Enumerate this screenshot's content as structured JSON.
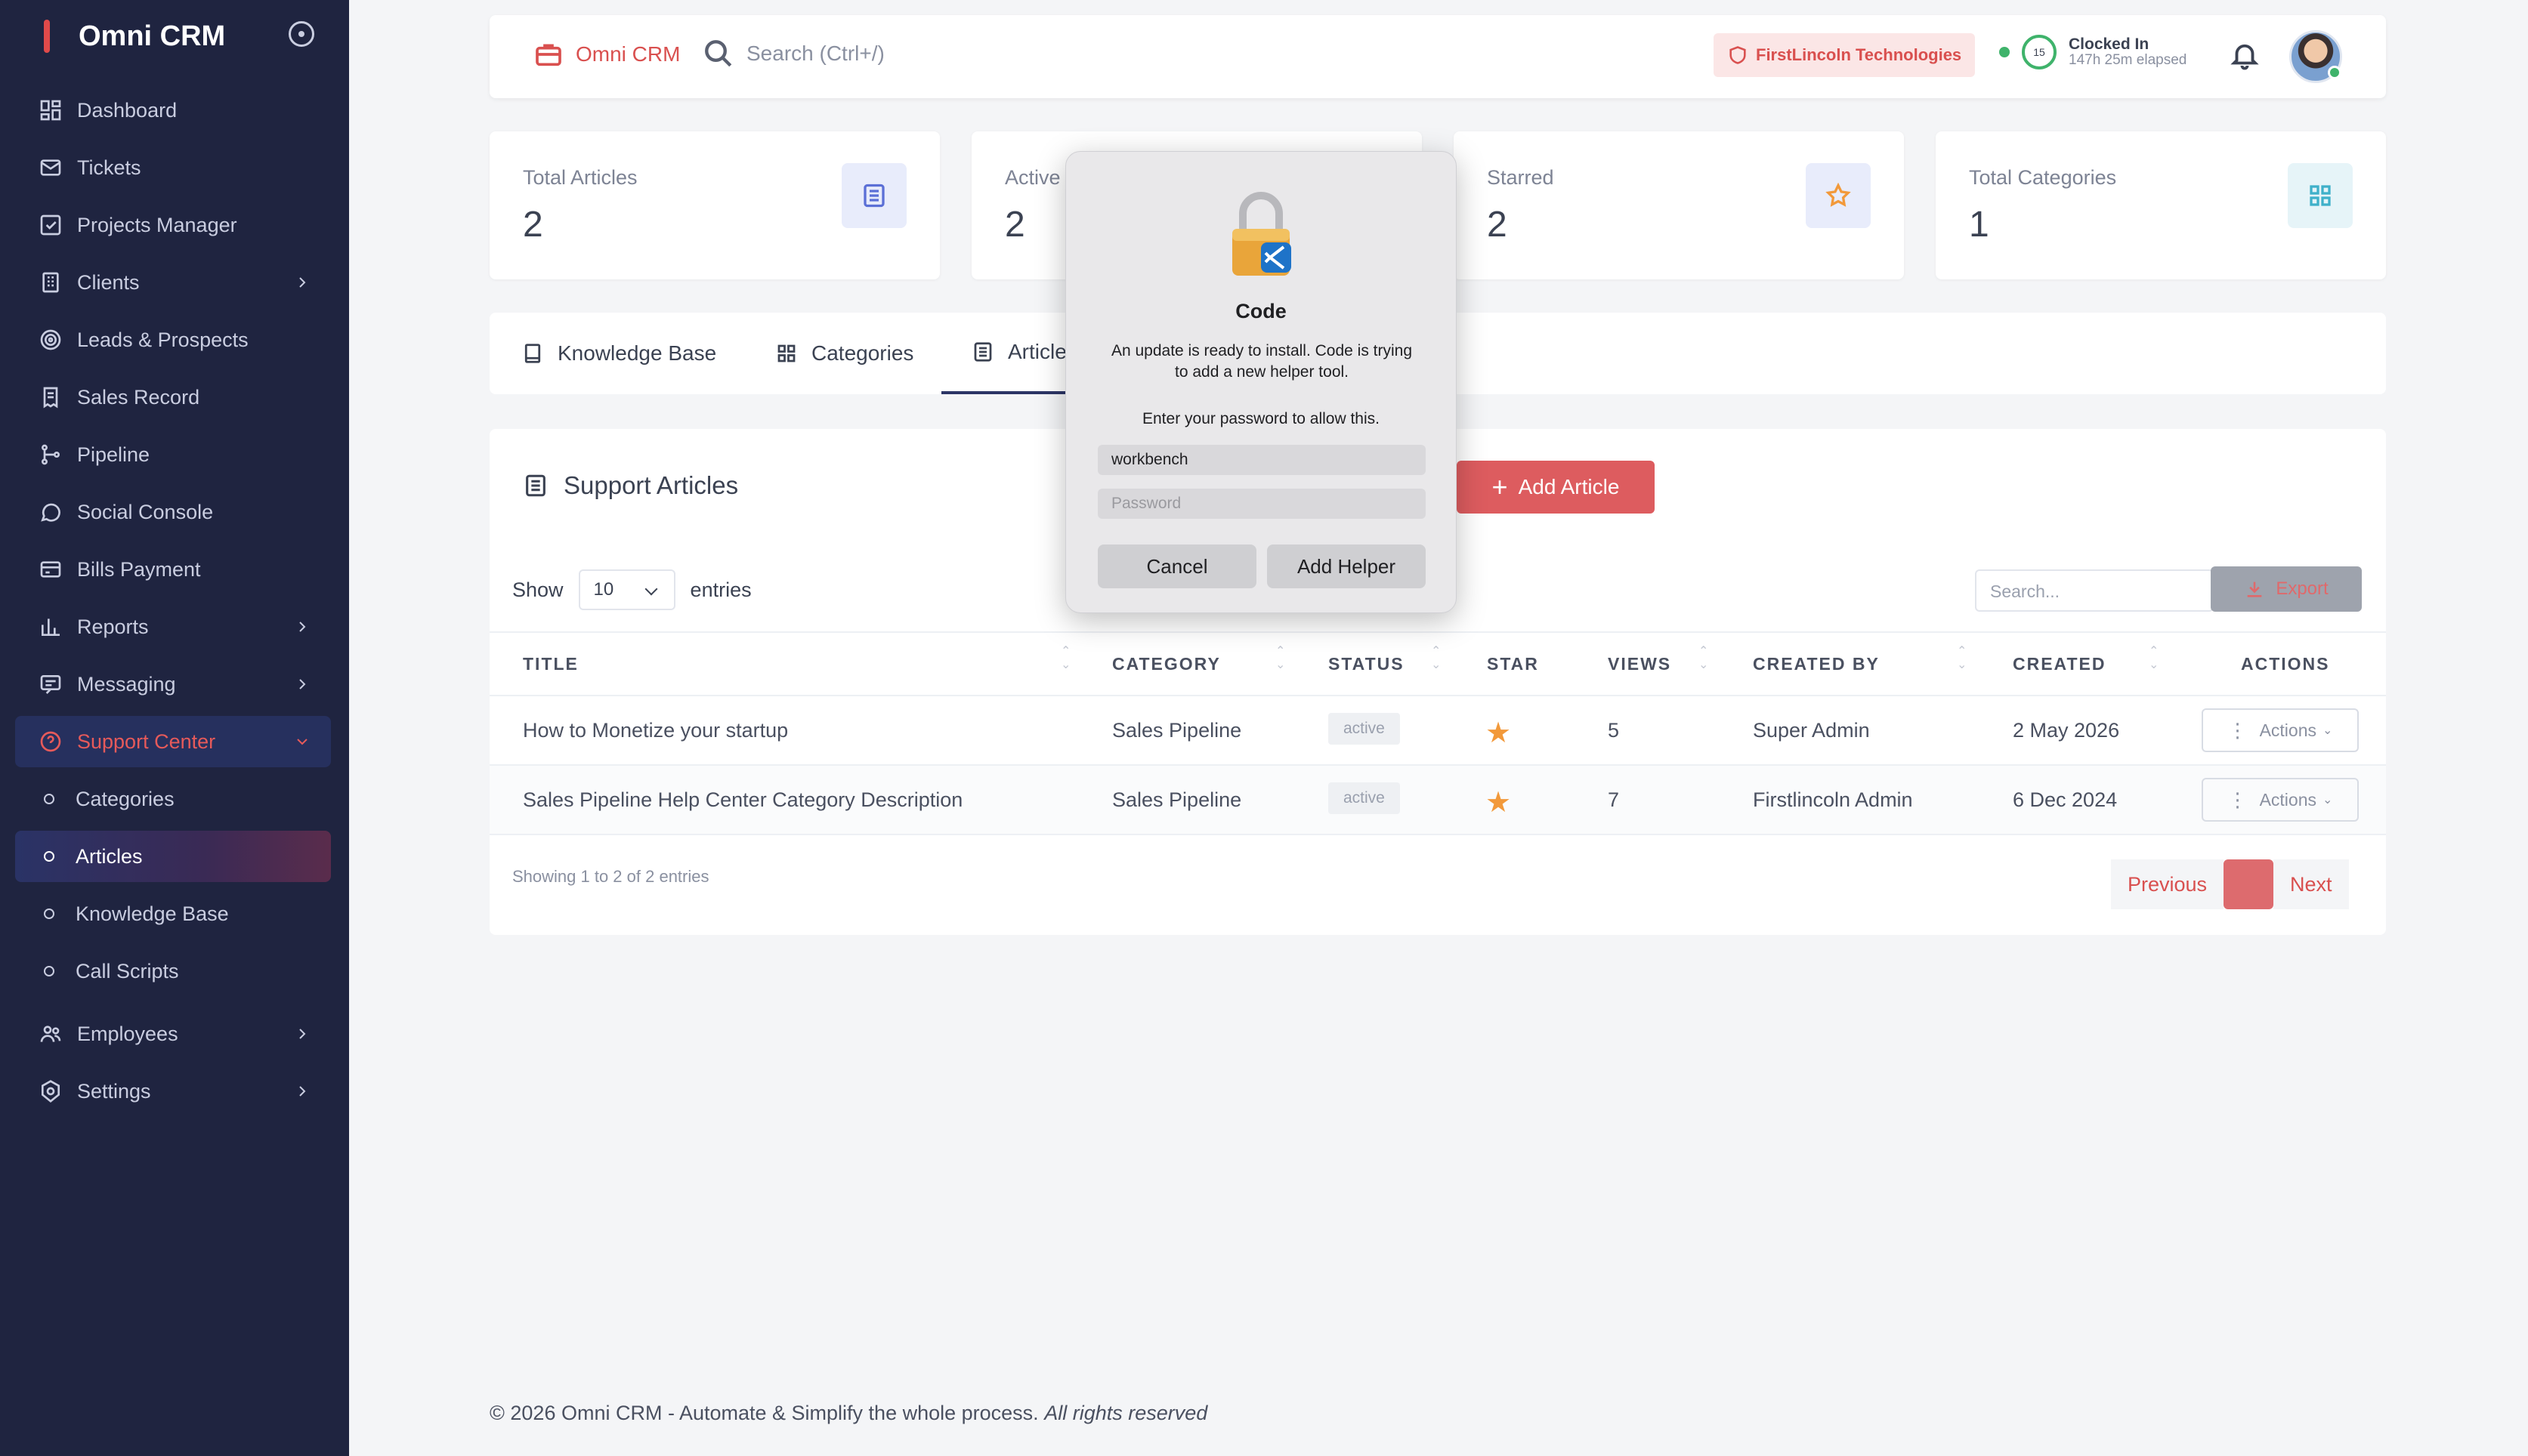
{
  "sidebar": {
    "brand": "Omni CRM",
    "items": [
      {
        "label": "Dashboard",
        "icon": "dashboard-icon"
      },
      {
        "label": "Tickets",
        "icon": "mail-icon"
      },
      {
        "label": "Projects Manager",
        "icon": "checklist-icon"
      },
      {
        "label": "Clients",
        "icon": "building-icon"
      },
      {
        "label": "Leads & Prospects",
        "icon": "target-icon"
      },
      {
        "label": "Sales Record",
        "icon": "receipt-icon"
      },
      {
        "label": "Pipeline",
        "icon": "branch-icon"
      },
      {
        "label": "Social Console",
        "icon": "chat-icon"
      },
      {
        "label": "Bills Payment",
        "icon": "card-icon"
      },
      {
        "label": "Reports",
        "icon": "bar-chart-icon"
      },
      {
        "label": "Messaging",
        "icon": "message-icon"
      },
      {
        "label": "Support Center",
        "icon": "help-icon"
      },
      {
        "label": "Categories"
      },
      {
        "label": "Articles"
      },
      {
        "label": "Knowledge Base"
      },
      {
        "label": "Call Scripts"
      },
      {
        "label": "Employees",
        "icon": "users-icon"
      },
      {
        "label": "Settings",
        "icon": "settings-icon"
      }
    ]
  },
  "header": {
    "brand": "Omni CRM",
    "search_placeholder": "Search (Ctrl+/)",
    "company": "FirstLincoln Technologies",
    "clock_count": "15",
    "clock_status": "Clocked In",
    "clock_elapsed": "147h 25m elapsed"
  },
  "stats": [
    {
      "label": "Total Articles",
      "value": "2",
      "icon": "list-icon",
      "color": "#5b6fd6"
    },
    {
      "label": "Active",
      "value": "2",
      "icon": "check-icon",
      "color": "#3fb36b"
    },
    {
      "label": "Starred",
      "value": "2",
      "icon": "star-icon",
      "color": "#f2993a"
    },
    {
      "label": "Total Categories",
      "value": "1",
      "icon": "grid-icon",
      "color": "#3fb0c9"
    }
  ],
  "tabs": [
    {
      "label": "Knowledge Base"
    },
    {
      "label": "Categories"
    },
    {
      "label": "Articles"
    }
  ],
  "panel": {
    "title": "Support Articles",
    "add_label": "Add Article",
    "show_label": "Show",
    "entries_value": "10",
    "entries_label": "entries",
    "search_placeholder": "Search...",
    "export_label": "Export",
    "columns": [
      "TITLE",
      "CATEGORY",
      "STATUS",
      "STAR",
      "VIEWS",
      "CREATED BY",
      "CREATED",
      "ACTIONS"
    ],
    "rows": [
      {
        "title": "How to Monetize your startup",
        "category": "Sales Pipeline",
        "status": "active",
        "views": "5",
        "created_by": "Super Admin",
        "created": "2 May 2026",
        "actions": "Actions"
      },
      {
        "title": "Sales Pipeline Help Center Category Description",
        "category": "Sales Pipeline",
        "status": "active",
        "views": "7",
        "created_by": "Firstlincoln Admin",
        "created": "6 Dec 2024",
        "actions": "Actions"
      }
    ],
    "info": "Showing 1 to 2 of 2 entries",
    "prev": "Previous",
    "next": "Next"
  },
  "footer": {
    "text": "© 2026 Omni CRM - Automate & Simplify the whole process.",
    "rights": "All rights reserved"
  },
  "modal": {
    "title": "Code",
    "message": "An update is ready to install. Code is trying to add a new helper tool.",
    "prompt": "Enter your password to allow this.",
    "username": "workbench",
    "password_placeholder": "Password",
    "cancel": "Cancel",
    "confirm": "Add Helper"
  },
  "colors": {
    "accent": "#dd5c5f",
    "sidebar": "#1f2440",
    "success": "#3fb36b"
  }
}
